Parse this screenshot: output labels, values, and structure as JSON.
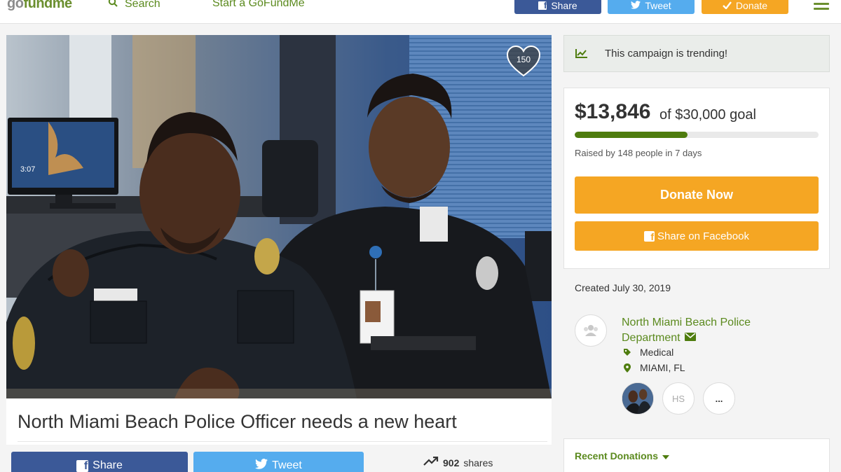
{
  "header": {
    "logo_part1": "go",
    "logo_part2": "fundme",
    "search_label": "Search",
    "start_label": "Start a GoFundMe",
    "share_label": "Share",
    "tweet_label": "Tweet",
    "donate_label": "Donate"
  },
  "hero": {
    "heart_count": "150",
    "screen_time": "3:07"
  },
  "campaign": {
    "title": "North Miami Beach Police Officer needs a new heart",
    "share_label": "Share",
    "tweet_label": "Tweet",
    "shares_count": "902",
    "shares_label": "shares"
  },
  "sidebar": {
    "trending_text": "This campaign is trending!",
    "raised": "$13,846",
    "goal_text": "of $30,000 goal",
    "progress_fraction": 0.4615,
    "raised_by": "Raised by 148 people in 7 days",
    "donate_now": "Donate Now",
    "share_facebook": "Share on Facebook",
    "created": "Created July 30, 2019",
    "organizer": "North Miami Beach Police Department",
    "category": "Medical",
    "location": "MIAMI, FL",
    "team": [
      "HS",
      "..."
    ],
    "recent_donations": "Recent Donations"
  },
  "colors": {
    "brand_green": "#5b8a1e",
    "facebook": "#3b5998",
    "twitter": "#55acee",
    "donate_orange": "#f5a623"
  }
}
